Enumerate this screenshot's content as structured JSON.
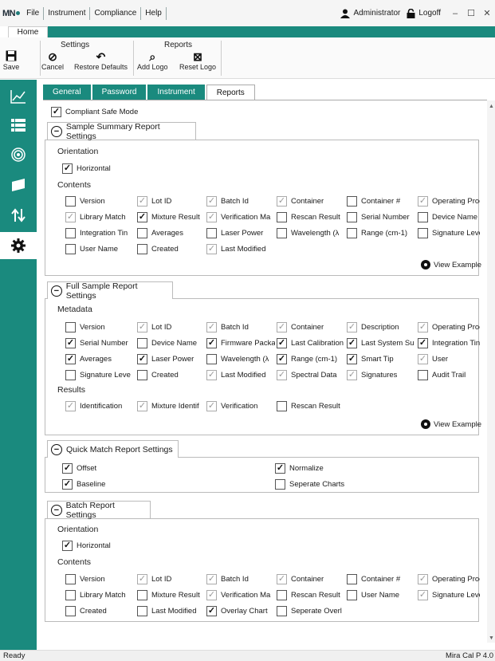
{
  "app": {
    "logo_text": "MN",
    "menu": [
      "File",
      "Instrument",
      "Compliance",
      "Help"
    ],
    "user": "Administrator",
    "logoff": "Logoff",
    "window_controls": [
      "minimize-icon",
      "maximize-icon",
      "close-icon"
    ]
  },
  "ribbon": {
    "home_tab": "Home",
    "settings_group": "Settings",
    "reports_group": "Reports",
    "buttons": {
      "save": "Save",
      "cancel": "Cancel",
      "restore": "Restore Defaults",
      "add_logo": "Add Logo",
      "reset_logo": "Reset Logo"
    }
  },
  "sidebar": {
    "items": [
      "chart-icon",
      "list-icon",
      "spiral-icon",
      "container-icon",
      "transfer-icon",
      "gear-icon"
    ],
    "active_index": 5,
    "accent": "#1a8a7e"
  },
  "tabs": [
    "General",
    "Password",
    "Instrument",
    "Reports"
  ],
  "active_tab": "Reports",
  "compliant_safe_mode": {
    "label": "Compliant Safe Mode",
    "state": "on"
  },
  "sample_summary": {
    "title": "Sample Summary Report Settings",
    "orientation_label": "Orientation",
    "horizontal": {
      "label": "Horizontal",
      "state": "on"
    },
    "contents_label": "Contents",
    "items": [
      {
        "label": "Version",
        "state": "off"
      },
      {
        "label": "Lot ID",
        "state": "dim"
      },
      {
        "label": "Batch Id",
        "state": "dim"
      },
      {
        "label": "Container",
        "state": "dim"
      },
      {
        "label": "Container #",
        "state": "off"
      },
      {
        "label": "Operating Proc",
        "state": "dim"
      },
      {
        "label": "Library Match",
        "state": "dim"
      },
      {
        "label": "Mixture Result",
        "state": "on"
      },
      {
        "label": "Verification Ma",
        "state": "dim"
      },
      {
        "label": "Rescan Result",
        "state": "off"
      },
      {
        "label": "Serial Number",
        "state": "off"
      },
      {
        "label": "Device Name",
        "state": "off"
      },
      {
        "label": "Integration Tin",
        "state": "off"
      },
      {
        "label": "Averages",
        "state": "off"
      },
      {
        "label": "Laser Power",
        "state": "off"
      },
      {
        "label": "Wavelength (λ",
        "state": "off"
      },
      {
        "label": "Range (cm-1)",
        "state": "off"
      },
      {
        "label": "Signature Leve",
        "state": "off"
      },
      {
        "label": "User Name",
        "state": "off"
      },
      {
        "label": "Created",
        "state": "off"
      },
      {
        "label": "Last Modified",
        "state": "dim"
      }
    ],
    "view_example": "View Example"
  },
  "full_sample": {
    "title": "Full Sample Report Settings",
    "metadata_label": "Metadata",
    "metadata": [
      {
        "label": "Version",
        "state": "off"
      },
      {
        "label": "Lot ID",
        "state": "dim"
      },
      {
        "label": "Batch Id",
        "state": "dim"
      },
      {
        "label": "Container",
        "state": "dim"
      },
      {
        "label": "Description",
        "state": "dim"
      },
      {
        "label": "Operating Proc",
        "state": "dim"
      },
      {
        "label": "Serial Number",
        "state": "on"
      },
      {
        "label": "Device Name",
        "state": "off"
      },
      {
        "label": "Firmware Packa",
        "state": "on"
      },
      {
        "label": "Last Calibration",
        "state": "on"
      },
      {
        "label": "Last System Su",
        "state": "on"
      },
      {
        "label": "Integration Tin",
        "state": "on"
      },
      {
        "label": "Averages",
        "state": "on"
      },
      {
        "label": "Laser Power",
        "state": "on"
      },
      {
        "label": "Wavelength (λ",
        "state": "off"
      },
      {
        "label": "Range (cm-1)",
        "state": "on"
      },
      {
        "label": "Smart Tip",
        "state": "on"
      },
      {
        "label": "User",
        "state": "dim"
      },
      {
        "label": "Signature Leve",
        "state": "off"
      },
      {
        "label": "Created",
        "state": "off"
      },
      {
        "label": "Last Modified",
        "state": "dim"
      },
      {
        "label": "Spectral Data",
        "state": "dim"
      },
      {
        "label": "Signatures",
        "state": "dim"
      },
      {
        "label": "Audit Trail",
        "state": "off"
      }
    ],
    "results_label": "Results",
    "results": [
      {
        "label": "Identification",
        "state": "dim"
      },
      {
        "label": "Mixture Identif",
        "state": "dim"
      },
      {
        "label": "Verification",
        "state": "dim"
      },
      {
        "label": "Rescan Result",
        "state": "off"
      }
    ],
    "view_example": "View Example"
  },
  "quick_match": {
    "title": "Quick Match Report Settings",
    "items": [
      {
        "label": "Offset",
        "state": "on"
      },
      {
        "label": "Normalize",
        "state": "on"
      },
      {
        "label": "Baseline",
        "state": "on"
      },
      {
        "label": "Seperate Charts",
        "state": "off"
      }
    ]
  },
  "batch": {
    "title": "Batch Report Settings",
    "orientation_label": "Orientation",
    "horizontal": {
      "label": "Horizontal",
      "state": "on"
    },
    "contents_label": "Contents",
    "items": [
      {
        "label": "Version",
        "state": "off"
      },
      {
        "label": "Lot ID",
        "state": "dim"
      },
      {
        "label": "Batch Id",
        "state": "dim"
      },
      {
        "label": "Container",
        "state": "dim"
      },
      {
        "label": "Container #",
        "state": "off"
      },
      {
        "label": "Operating Proc",
        "state": "dim"
      },
      {
        "label": "Library Match",
        "state": "off"
      },
      {
        "label": "Mixture Result",
        "state": "off"
      },
      {
        "label": "Verification Ma",
        "state": "dim"
      },
      {
        "label": "Rescan Result",
        "state": "off"
      },
      {
        "label": "User Name",
        "state": "off"
      },
      {
        "label": "Signature Leve",
        "state": "dim"
      },
      {
        "label": "Created",
        "state": "off"
      },
      {
        "label": "Last Modified",
        "state": "off"
      },
      {
        "label": "Overlay Chart",
        "state": "on"
      },
      {
        "label": "Seperate Overl",
        "state": "off"
      }
    ]
  },
  "status": {
    "left": "Ready",
    "right": "Mira Cal P 4.0"
  }
}
